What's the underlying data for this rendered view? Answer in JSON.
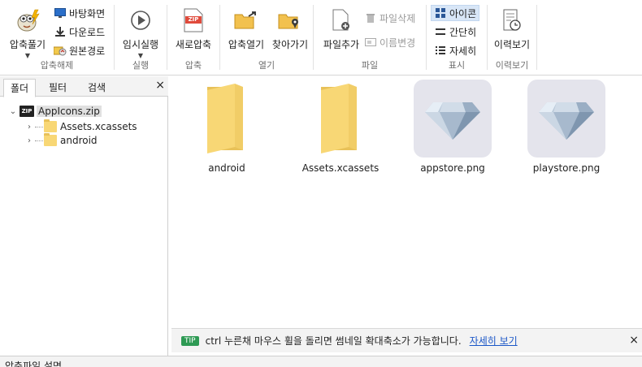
{
  "ribbon": {
    "groups": {
      "extract": {
        "label": "압축해제",
        "big": "압축풀기",
        "items": [
          "바탕화면",
          "다운로드",
          "원본경로"
        ]
      },
      "run": {
        "label": "실행",
        "big": "임시실행"
      },
      "compress": {
        "label": "압축",
        "big": "새로압축",
        "zip_badge": "ZIP"
      },
      "open": {
        "label": "열기",
        "items": [
          "압축열기",
          "찾아가기"
        ]
      },
      "file": {
        "label": "파일",
        "big": "파일추가",
        "items": [
          "파일삭제",
          "이름변경"
        ]
      },
      "view": {
        "label": "표시",
        "items": [
          "아이콘",
          "간단히",
          "자세히"
        ]
      },
      "history": {
        "label": "이력보기",
        "big": "이력보기"
      }
    }
  },
  "left_panel": {
    "tabs": [
      "폴더",
      "필터",
      "검색"
    ],
    "active_tab": "폴더",
    "close": "×",
    "tree": {
      "root": {
        "label": "AppIcons.zip",
        "badge": "ZIP"
      },
      "children": [
        "Assets.xcassets",
        "android"
      ]
    }
  },
  "main": {
    "items": [
      {
        "name": "android",
        "type": "folder"
      },
      {
        "name": "Assets.xcassets",
        "type": "folder"
      },
      {
        "name": "appstore.png",
        "type": "image"
      },
      {
        "name": "playstore.png",
        "type": "image"
      }
    ]
  },
  "tip": {
    "badge": "TIP",
    "text": "ctrl 누른채 마우스 휠을 돌리면 썸네일 확대축소가 가능합니다.",
    "link": "자세히 보기",
    "close": "×"
  },
  "bottom": {
    "label": "압축파일 설명"
  },
  "colors": {
    "folder": "#f8d775",
    "folder_dark": "#e8c158",
    "accent_link": "#1a56c7",
    "tip_badge": "#2e9a54",
    "active_view": "#d8e6f7"
  }
}
